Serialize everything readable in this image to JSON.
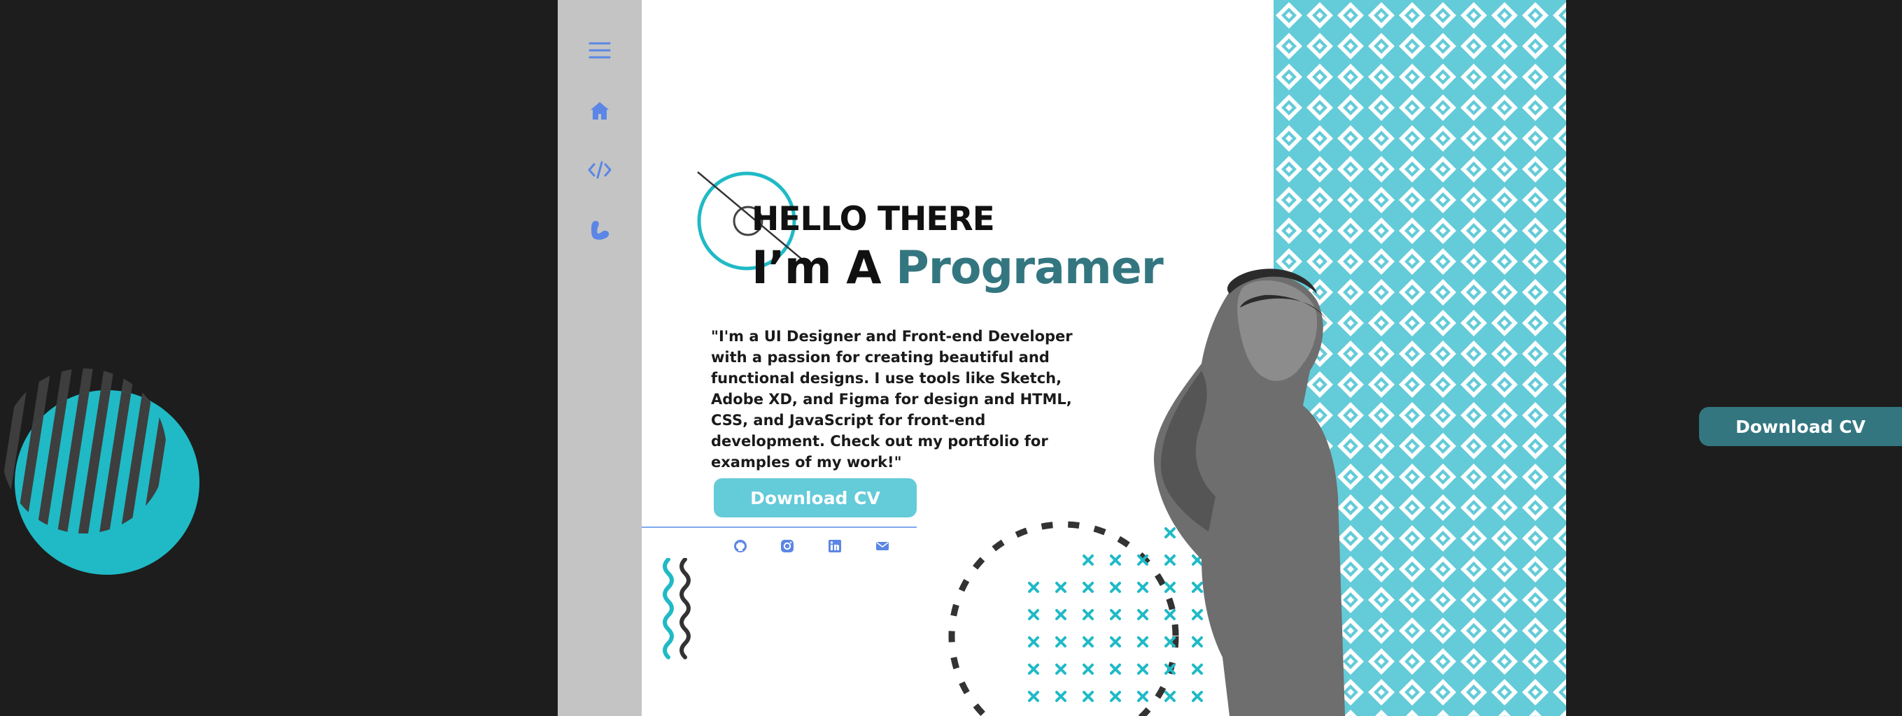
{
  "sidebar": {
    "items": [
      {
        "icon": "menu-icon"
      },
      {
        "icon": "home-icon"
      },
      {
        "icon": "code-icon"
      },
      {
        "icon": "bicep-icon"
      }
    ]
  },
  "hero": {
    "greeting": "HELLO THERE",
    "headline_prefix": "I’m A ",
    "headline_accent": "Programer",
    "bio": "\"I'm a UI Designer and Front-end Developer with a passion for creating beautiful and functional designs. I use tools like Sketch, Adobe XD, and Figma for design and HTML, CSS, and JavaScript for front-end development. Check out my portfolio for examples of my work!\"",
    "cv_button": "Download CV"
  },
  "socials": [
    {
      "icon": "github-icon"
    },
    {
      "icon": "instagram-icon"
    },
    {
      "icon": "linkedin-icon"
    },
    {
      "icon": "mail-icon"
    }
  ],
  "floating_cv_button": "Download CV",
  "colors": {
    "background": "#1d1d1d",
    "sidebar": "#c4c4c4",
    "accent_teal": "#1fbac6",
    "pattern_teal": "#64cbd8",
    "headline_accent": "#337680",
    "icon_blue": "#5b86e5",
    "cv_button": "#64cbd8",
    "floating_button": "#337680"
  }
}
